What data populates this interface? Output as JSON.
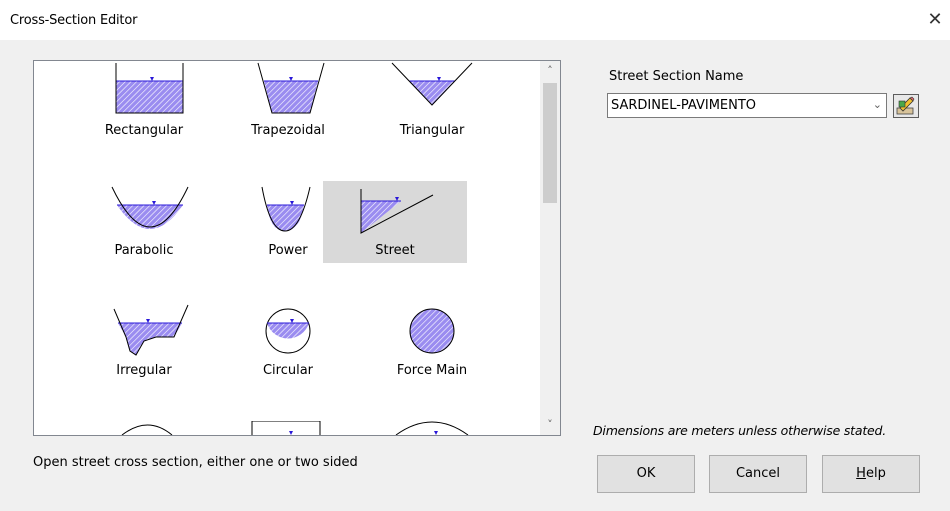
{
  "window": {
    "title": "Cross-Section Editor",
    "close_glyph": "✕"
  },
  "shapes": [
    {
      "name": "Rectangular",
      "icon": "rectangular-icon"
    },
    {
      "name": "Trapezoidal",
      "icon": "trapezoidal-icon"
    },
    {
      "name": "Triangular",
      "icon": "triangular-icon"
    },
    {
      "name": "Parabolic",
      "icon": "parabolic-icon"
    },
    {
      "name": "Power",
      "icon": "power-icon"
    },
    {
      "name": "Street",
      "icon": "street-icon",
      "selected": true
    },
    {
      "name": "Irregular",
      "icon": "irregular-icon"
    },
    {
      "name": "Circular",
      "icon": "circular-icon"
    },
    {
      "name": "Force Main",
      "icon": "force-main-icon"
    }
  ],
  "scrollbar": {
    "up_glyph": "˄",
    "down_glyph": "˅"
  },
  "status_text": "Open street cross section, either one or two sided",
  "street_section": {
    "label": "Street Section Name",
    "value": "SARDINEL-PAVIMENTO",
    "arrow_glyph": "⌄"
  },
  "note": "Dimensions are meters unless otherwise stated.",
  "buttons": {
    "ok": "OK",
    "cancel": "Cancel",
    "help_mnemonic": "H",
    "help_rest": "elp"
  },
  "colors": {
    "water_fill": "#8f7fe6",
    "water_line": "#2a18d8",
    "selection": "#d9d9d9"
  }
}
